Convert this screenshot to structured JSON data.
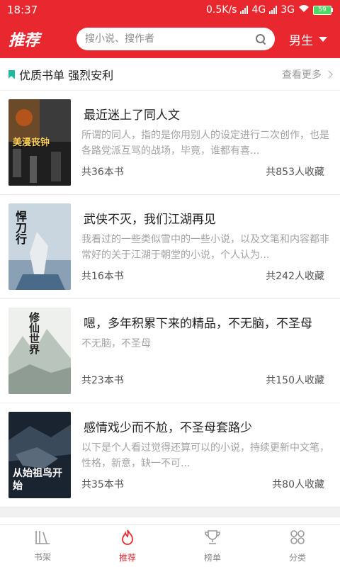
{
  "status_bar": {
    "time": "18:37",
    "network_speed": "0.5K/s",
    "network_1": "4G",
    "network_2": "3G",
    "battery": "59"
  },
  "header": {
    "title": "推荐",
    "search_placeholder": "搜小说、搜作者",
    "gender_selector": "男生"
  },
  "section": {
    "title": "优质书单 强烈安利",
    "more_label": "查看更多"
  },
  "booklists": [
    {
      "title": "最近迷上了同人文",
      "description": "所谓的同人，指的是你用别人的设定进行二次创作，也是各路党派互骂的战场，毕竟，谁都有喜...",
      "count": "共36本书",
      "favorites": "共853人收藏",
      "cover_text": "美漫丧钟",
      "cover_colors": [
        "#2a2a2a",
        "#7a5a2a",
        "#b33a1a"
      ]
    },
    {
      "title": "武侠不灭，我们江湖再见",
      "description": "我看过的一些类似雪中的一些小说，以及文笔和内容都非常好的关于江湖于朝堂的小说，个人认为...",
      "count": "共16本书",
      "favorites": "共242人收藏",
      "cover_text": "悍刀行",
      "cover_colors": [
        "#c9d6df",
        "#4a6a8a",
        "#1a1a1a"
      ]
    },
    {
      "title": "嗯，多年积累下来的精品，不无脑，不圣母",
      "description": "不无脑，不圣母",
      "count": "共23本书",
      "favorites": "共150人收藏",
      "cover_text": "修仙世界",
      "cover_colors": [
        "#eef0ee",
        "#b9c4bd",
        "#222222"
      ]
    },
    {
      "title": "感情戏少而不尬，不圣母套路少",
      "description": "以下是个人看过觉得还算可以的小说，持续更新中文笔，性格，新意，缺一不可...",
      "count": "共35本书",
      "favorites": "共80人收藏",
      "cover_text": "从始祖鸟开始",
      "cover_colors": [
        "#1a2430",
        "#3a4a5a",
        "#ffffff"
      ]
    }
  ],
  "bottom_nav": [
    {
      "label": "书架",
      "icon": "bookshelf-icon",
      "active": false
    },
    {
      "label": "推荐",
      "icon": "flame-icon",
      "active": true
    },
    {
      "label": "榜单",
      "icon": "trophy-icon",
      "active": false
    },
    {
      "label": "分类",
      "icon": "category-icon",
      "active": false
    }
  ],
  "accent_color": "#e8282e"
}
